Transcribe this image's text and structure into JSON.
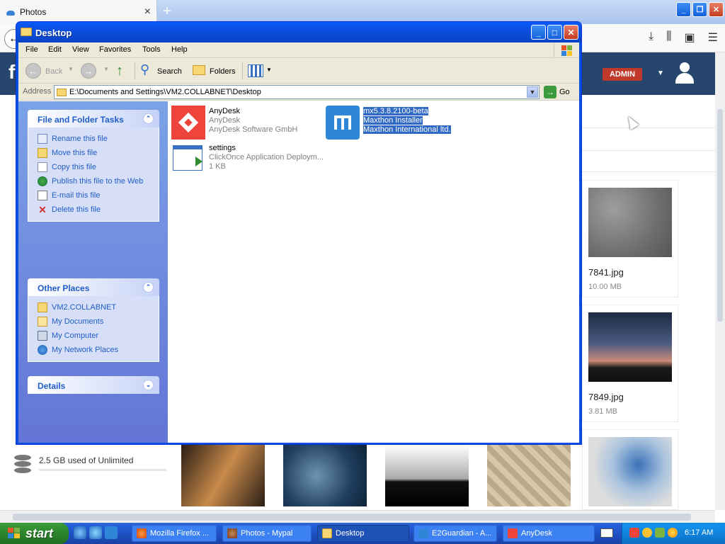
{
  "browser": {
    "tab_title": "Photos",
    "tab_close": "×",
    "new_tab": "+"
  },
  "site": {
    "admin_badge": "ADMIN",
    "storage_text": "2.5 GB used of Unlimited",
    "photos": [
      {
        "name": "7841.jpg",
        "size": "10.00 MB"
      },
      {
        "name": "7849.jpg",
        "size": "3.81 MB"
      }
    ]
  },
  "explorer": {
    "title": "Desktop",
    "menu": [
      "File",
      "Edit",
      "View",
      "Favorites",
      "Tools",
      "Help"
    ],
    "toolbar": {
      "back": "Back",
      "search": "Search",
      "folders": "Folders"
    },
    "address": {
      "label": "Address",
      "value": "E:\\Documents and Settings\\VM2.COLLABNET\\Desktop",
      "go": "Go"
    },
    "tasks": {
      "title": "File and Folder Tasks",
      "items": [
        "Rename this file",
        "Move this file",
        "Copy this file",
        "Publish this file to the Web",
        "E-mail this file",
        "Delete this file"
      ]
    },
    "other_places": {
      "title": "Other Places",
      "items": [
        "VM2.COLLABNET",
        "My Documents",
        "My Computer",
        "My Network Places"
      ]
    },
    "details": {
      "title": "Details"
    },
    "files": [
      {
        "line1": "AnyDesk",
        "line2": "AnyDesk",
        "line3": "AnyDesk Software GmbH",
        "selected": false
      },
      {
        "line1": "mx5.3.8.2100-beta",
        "line2": "Maxthon Installer",
        "line3": "Maxthon International ltd.",
        "selected": true
      },
      {
        "line1": "settings",
        "line2": "ClickOnce Application Deploym...",
        "line3": "1 KB",
        "selected": false
      }
    ]
  },
  "taskbar": {
    "start": "start",
    "tasks": [
      "Mozilla Firefox ...",
      "Photos - Mypal",
      "Desktop",
      "E2Guardian - A...",
      "AnyDesk"
    ],
    "clock": "6:17 AM"
  },
  "colors": {
    "xp_blue": "#0a4fe0",
    "task_link": "#215dc6",
    "selection": "#316ac5",
    "anydesk_red": "#ef443b",
    "maxthon_blue": "#2f86d8",
    "admin_red": "#c0392b"
  }
}
